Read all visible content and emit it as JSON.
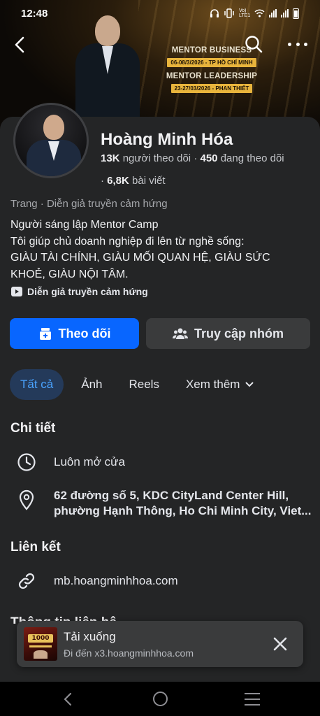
{
  "status_bar": {
    "time": "12:48",
    "network_label": "Vo) LTE1"
  },
  "cover": {
    "event1_title": "MENTOR BUSINESS",
    "event1_badge": "06-08/3/2026 - TP HỒ CHÍ MINH",
    "event2_title": "MENTOR LEADERSHIP",
    "event2_badge": "23-27/03/2026 - PHAN THIẾT",
    "icons": [
      "back-icon",
      "search-icon",
      "more-icon"
    ]
  },
  "profile": {
    "name": "Hoàng Minh Hóa",
    "followers_count": "13K",
    "followers_label": "người theo dõi",
    "separator": "·",
    "following_count": "450",
    "following_label": "đang theo dõi",
    "posts_count": "6,8K",
    "posts_label": "bài viết",
    "category": "Trang · Diễn giả truyền cảm hứng",
    "bio_line1": "Người sáng lập Mentor Camp",
    "bio_line2": "Tôi giúp chủ doanh nghiệp đi lên từ nghề sống:",
    "bio_line3": "GIÀU TÀI CHÍNH, GIÀU MỐI QUAN HỆ, GIÀU SỨC",
    "bio_line4": "KHOẺ, GIÀU NỘI TÂM.",
    "tag": "Diễn giả truyền cảm hứng"
  },
  "actions": {
    "follow_label": "Theo dõi",
    "group_label": "Truy cập nhóm",
    "accent_color": "#0866ff"
  },
  "tabs": [
    {
      "label": "Tất cả",
      "active": true
    },
    {
      "label": "Ảnh",
      "active": false
    },
    {
      "label": "Reels",
      "active": false
    },
    {
      "label": "Xem thêm",
      "active": false
    }
  ],
  "details": {
    "title": "Chi tiết",
    "hours": "Luôn mở cửa",
    "address_line1": "62 đường số 5, KDC CityLand Center Hill,",
    "address_line2": "phường Hạnh Thông, Ho Chi Minh City, Viet..."
  },
  "links": {
    "title": "Liên kết",
    "website": "mb.hoangminhhoa.com"
  },
  "contact": {
    "title": "Thông tin liên hệ"
  },
  "download_toast": {
    "thumb_text": "1000",
    "title": "Tải xuống",
    "subtitle": "Đi đến x3.hoangminhhoa.com"
  }
}
